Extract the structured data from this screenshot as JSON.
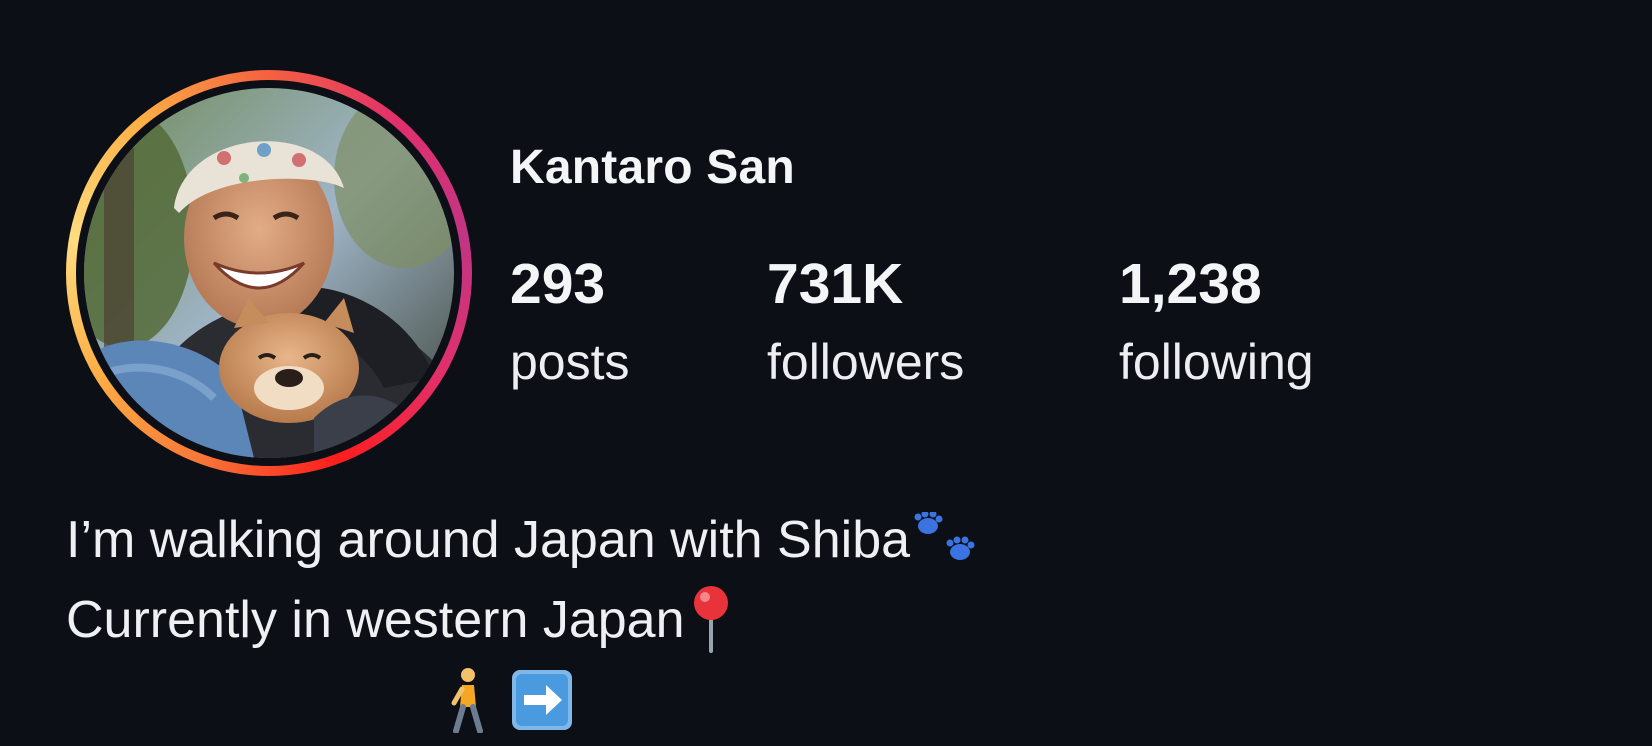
{
  "profile": {
    "display_name": "Kantaro San",
    "avatar_alt": "profile-photo-man-with-shiba-puppy",
    "story_ring": true,
    "ring_colors": [
      "#f77737",
      "#fcaf45",
      "#e1306c",
      "#c13584"
    ]
  },
  "stats": {
    "posts": {
      "count": "293",
      "label": "posts"
    },
    "followers": {
      "count": "731K",
      "label": "followers"
    },
    "following": {
      "count": "1,238",
      "label": "following"
    }
  },
  "bio": {
    "line1": "I’m walking around Japan with Shiba",
    "line1_icon": "paw-prints-icon",
    "line2": "Currently in western Japan",
    "line2_icon": "round-pushpin-icon",
    "line3_icons": [
      "person-walking-icon",
      "right-arrow-icon"
    ]
  },
  "colors": {
    "background": "#0c0f16",
    "text": "#f2f3f5",
    "emoji_blue": "#3b73e0",
    "pin_red": "#e8333a",
    "arrow_box": "#7fb7e8"
  }
}
